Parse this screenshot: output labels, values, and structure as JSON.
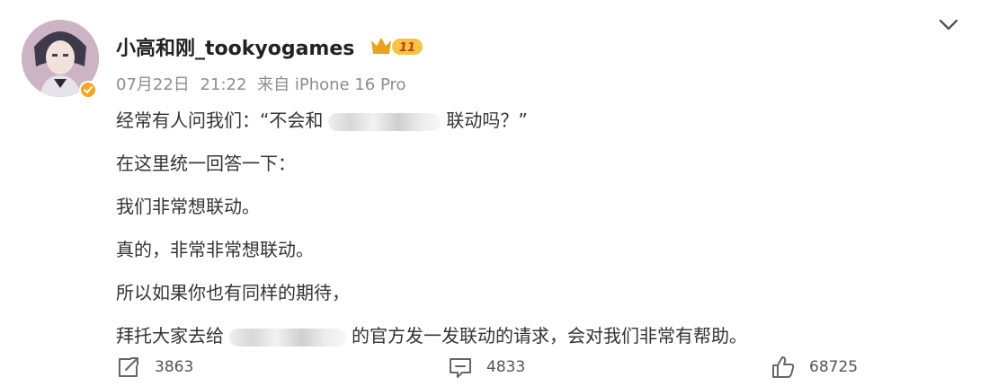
{
  "post": {
    "username": "小高和刚_tookyogames",
    "vip_badge": "11",
    "date": "07月22日",
    "time": "21:22",
    "source": "来自 iPhone 16 Pro",
    "lines": [
      {
        "before": "经常有人问我们：“不会和",
        "after": "联动吗？”"
      },
      {
        "text": "在这里统一回答一下："
      },
      {
        "text": "我们非常想联动。"
      },
      {
        "text": "真的，非常非常想联动。"
      },
      {
        "text": "所以如果你也有同样的期待，"
      },
      {
        "before": "拜托大家去给",
        "after": "的官方发一发联动的请求，会对我们非常有帮助。"
      }
    ]
  },
  "actions": {
    "reposts": "3863",
    "comments": "4833",
    "likes": "68725"
  },
  "icons": {
    "verified": "verified-badge-icon",
    "vip": "crown-vip-icon",
    "menu": "chevron-down-icon",
    "repost": "repost-icon",
    "comment": "comment-icon",
    "like": "thumbs-up-icon"
  },
  "colors": {
    "username": "#222222",
    "meta": "#8d8d8d",
    "text": "#333333",
    "verified": "#f5a623",
    "vip_gold": "#e9a21a"
  }
}
